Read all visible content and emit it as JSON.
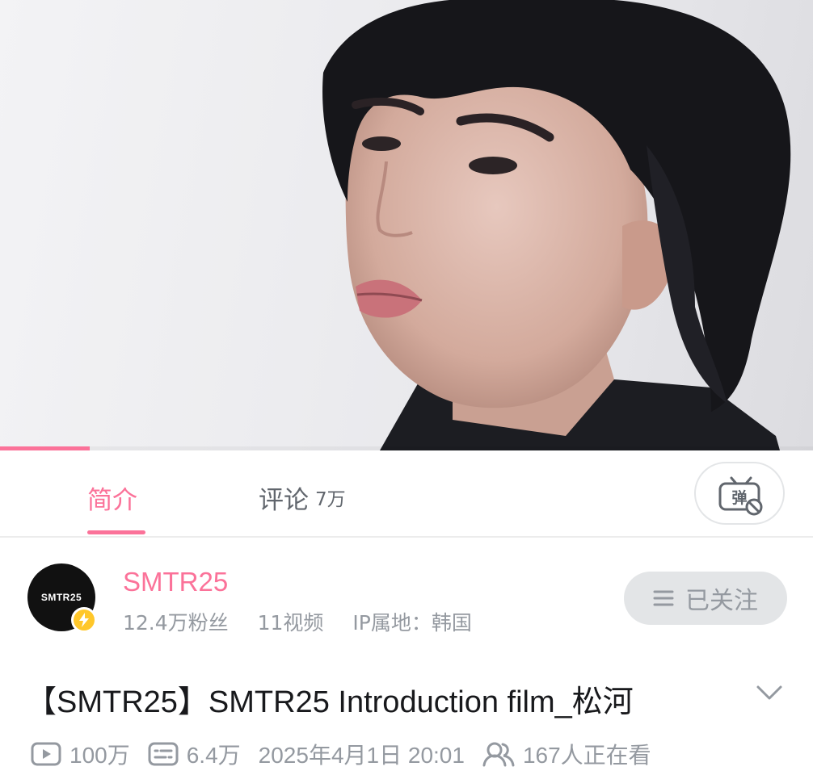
{
  "video": {
    "progress_fraction": 0.11
  },
  "tabs": {
    "intro_label": "简介",
    "comments_label": "评论",
    "comments_count": "7万",
    "danmaku_glyph": "弹"
  },
  "uploader": {
    "avatar_text": "SMTR25",
    "name": "SMTR25",
    "fans": "12.4万粉丝",
    "videos": "11视频",
    "ip": "IP属地：韩国",
    "follow_label": "已关注"
  },
  "title": "【SMTR25】SMTR25 Introduction film_松河",
  "stats": {
    "plays": "100万",
    "danmaku": "6.4万",
    "date": "2025年4月1日 20:01",
    "watching": "167人正在看"
  },
  "colors": {
    "accent": "#fb7299",
    "muted": "#9499a0",
    "badge": "#ffc72a"
  },
  "icons": [
    "danmaku-toggle-icon",
    "verified-lightning-icon",
    "menu-lines-icon",
    "chevron-down-icon",
    "play-count-icon",
    "danmaku-count-icon",
    "viewers-icon"
  ]
}
